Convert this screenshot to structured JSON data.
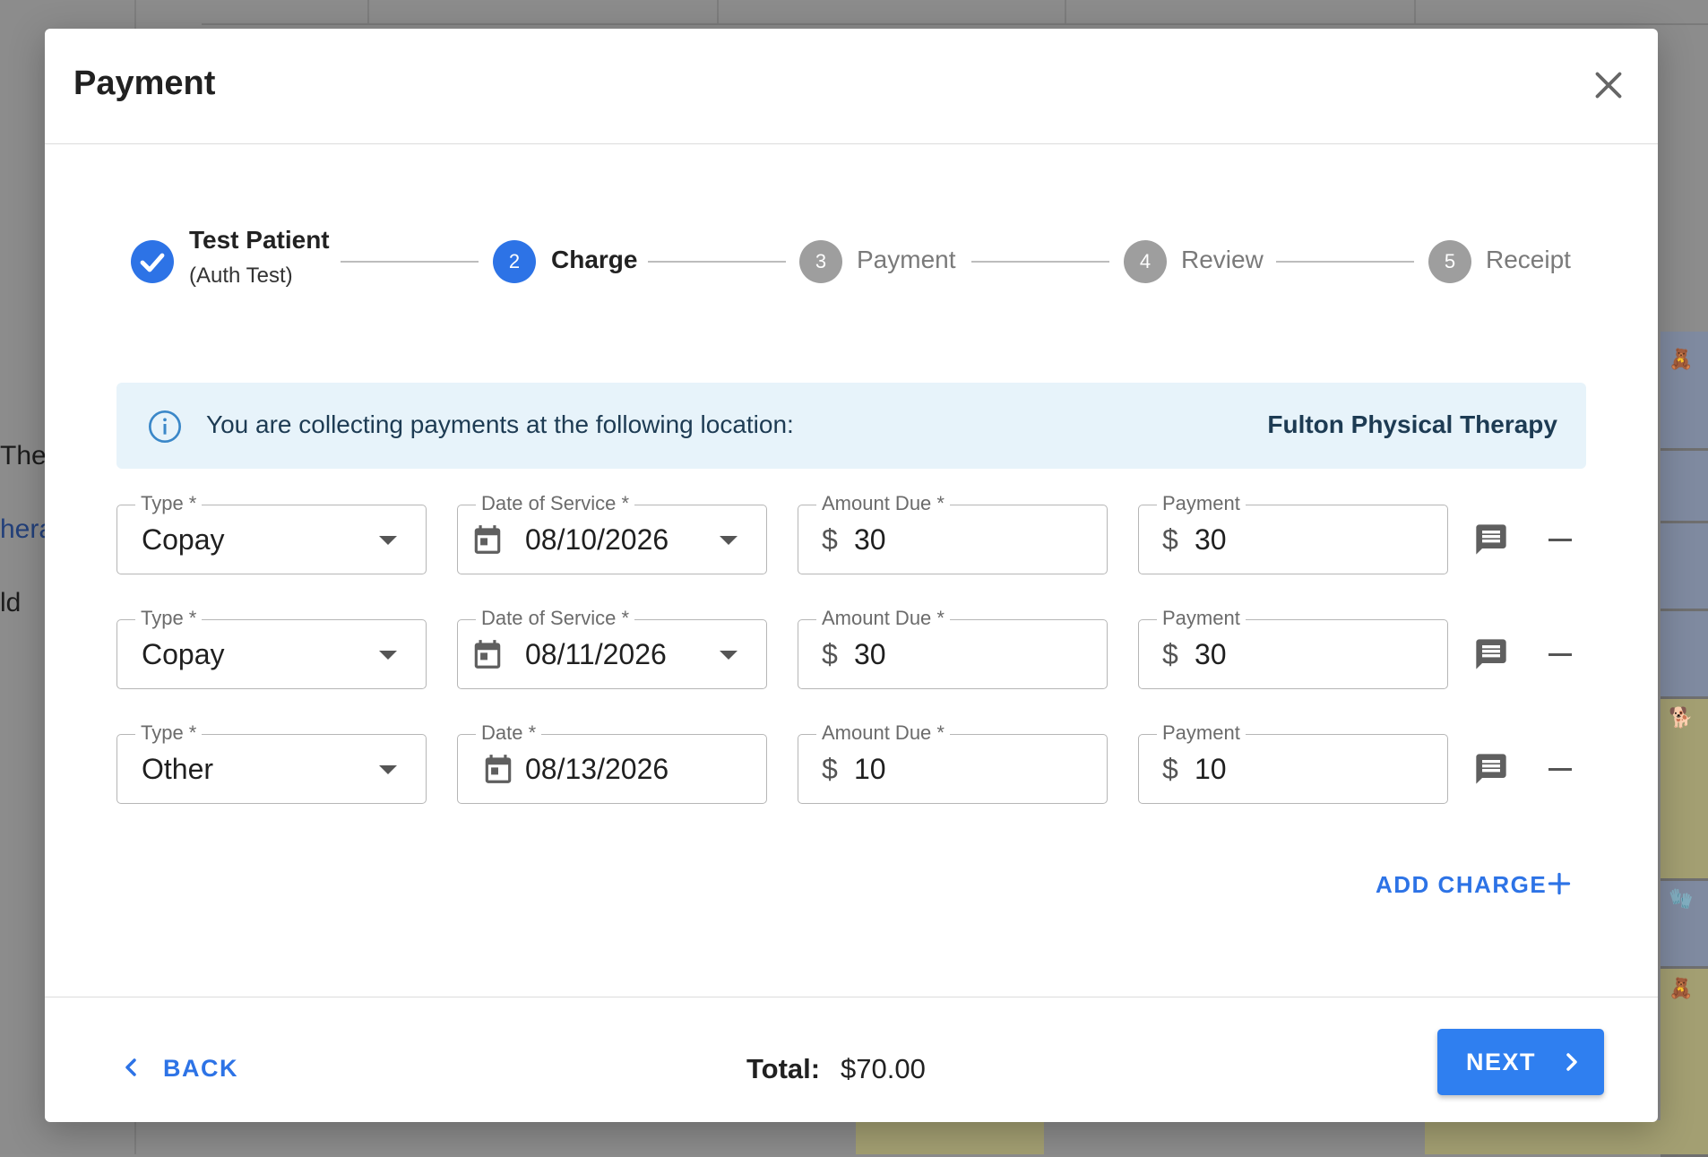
{
  "background": {
    "text_1": "The",
    "text_2": "hera",
    "text_3": "ld"
  },
  "modal": {
    "title": "Payment",
    "close_icon": "close-icon"
  },
  "stepper": {
    "steps": [
      {
        "number": "",
        "label": "Test Patient",
        "sublabel": "(Auth Test)",
        "state": "completed"
      },
      {
        "number": "2",
        "label": "Charge",
        "state": "active"
      },
      {
        "number": "3",
        "label": "Payment",
        "state": "inactive"
      },
      {
        "number": "4",
        "label": "Review",
        "state": "inactive"
      },
      {
        "number": "5",
        "label": "Receipt",
        "state": "inactive"
      }
    ]
  },
  "info_banner": {
    "text": "You are collecting payments at the following location:",
    "location": "Fulton Physical Therapy"
  },
  "charges": [
    {
      "type_label": "Type *",
      "type": "Copay",
      "date_label": "Date of Service *",
      "date": "08/10/2026",
      "date_has_dropdown": true,
      "amount_label": "Amount Due *",
      "currency": "$",
      "amount_due": "30",
      "payment_label": "Payment",
      "payment": "30"
    },
    {
      "type_label": "Type *",
      "type": "Copay",
      "date_label": "Date of Service *",
      "date": "08/11/2026",
      "date_has_dropdown": true,
      "amount_label": "Amount Due *",
      "currency": "$",
      "amount_due": "30",
      "payment_label": "Payment",
      "payment": "30"
    },
    {
      "type_label": "Type *",
      "type": "Other",
      "date_label": "Date *",
      "date": "08/13/2026",
      "date_has_dropdown": false,
      "amount_label": "Amount Due *",
      "currency": "$",
      "amount_due": "10",
      "payment_label": "Payment",
      "payment": "10"
    }
  ],
  "add_charge": {
    "label": "ADD CHARGE"
  },
  "footer": {
    "back_label": "BACK",
    "total_label": "Total:",
    "total_value": "$70.00",
    "next_label": "NEXT"
  },
  "colors": {
    "primary": "#2d73e6",
    "info_bg": "#e7f3fa",
    "inactive_step": "#9e9e9e"
  }
}
